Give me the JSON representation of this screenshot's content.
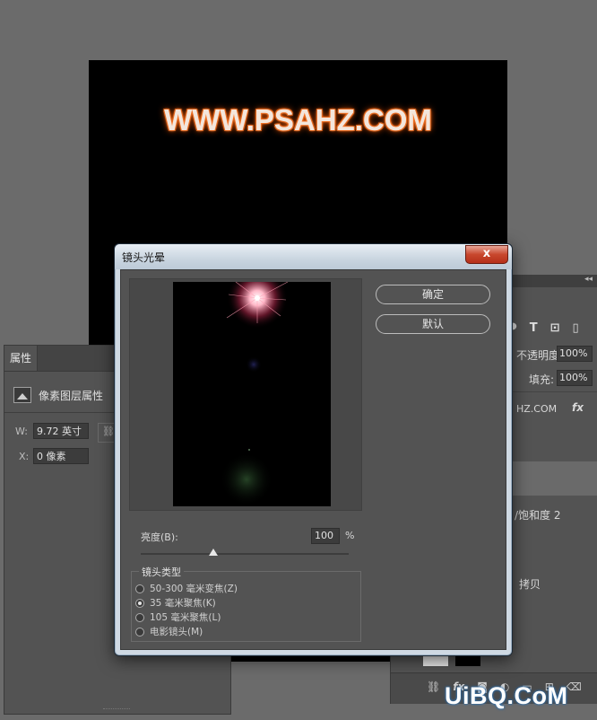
{
  "document": {
    "canvas_text": "WWW.PSAHZ.COM"
  },
  "properties_panel": {
    "tab_label": "属性",
    "section_title": "像素图层属性",
    "width_label": "W:",
    "width_value": "9.72 英寸",
    "x_label": "X:",
    "x_value": "0 像素"
  },
  "layers_panel": {
    "opacity_label": "不透明度:",
    "opacity_value": "100%",
    "fill_label": "填充:",
    "fill_value": "100%",
    "text_layer_partial": "HZ.COM",
    "fx_label": "fx",
    "hue_sat_partial": "/饱和度 2",
    "copy_partial": "拷贝",
    "bottom_icons": [
      "link-icon",
      "fx-icon",
      "mask-icon",
      "adjustment-icon",
      "folder-icon",
      "new-layer-icon",
      "trash-icon"
    ]
  },
  "dialog": {
    "title": "镜头光晕",
    "close_label": "x",
    "ok_label": "确定",
    "default_label": "默认",
    "brightness_label": "亮度(B):",
    "brightness_value": "100",
    "brightness_unit": "%",
    "brightness_slider_fraction": 0.35,
    "lens_type_title": "镜头类型",
    "lens_types": [
      {
        "label": "50-300 毫米变焦(Z)",
        "selected": false
      },
      {
        "label": "35 毫米聚焦(K)",
        "selected": true
      },
      {
        "label": "105 毫米聚焦(L)",
        "selected": false
      },
      {
        "label": "电影镜头(M)",
        "selected": false
      }
    ]
  },
  "watermark": {
    "text": "UiBQ.CoM"
  },
  "colors": {
    "workspace": "#6b6b6b",
    "panel": "#535353",
    "close_button": "#c8472d",
    "canvas_text_glow": "#ff7a2a"
  }
}
